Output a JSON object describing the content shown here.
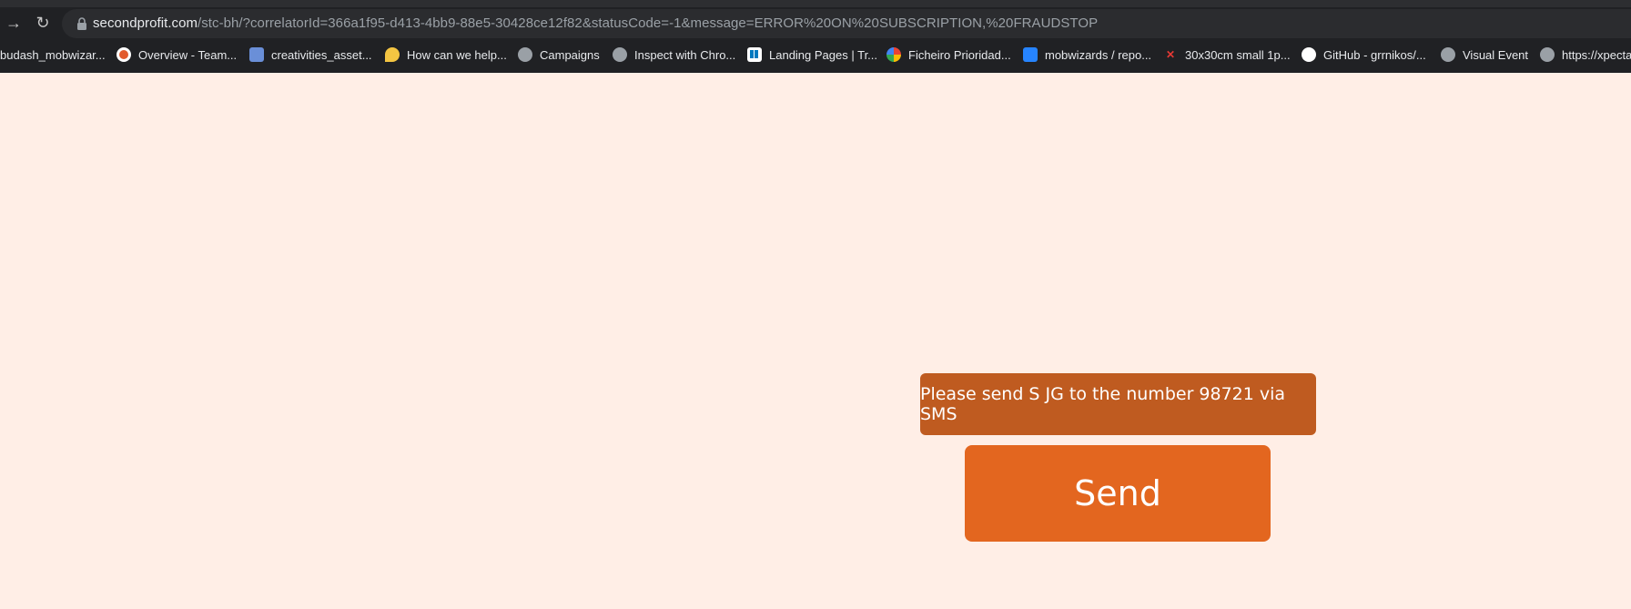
{
  "browser": {
    "url_host": "secondprofit.com",
    "url_path": "/stc-bh/?correlatorId=366a1f95-d413-4bb9-88e5-30428ce12f82&statusCode=-1&message=ERROR%20ON%20SUBSCRIPTION,%20FRAUDSTOP",
    "bookmarks": [
      {
        "label": "budash_mobwizar...",
        "icon": "none"
      },
      {
        "label": "Overview - Team...",
        "icon": "mobwizards-icon"
      },
      {
        "label": "creativities_asset...",
        "icon": "grid-icon"
      },
      {
        "label": "How can we help...",
        "icon": "help-icon"
      },
      {
        "label": "Campaigns",
        "icon": "globe-icon"
      },
      {
        "label": "Inspect with Chro...",
        "icon": "globe-icon"
      },
      {
        "label": "Landing Pages | Tr...",
        "icon": "trello-icon"
      },
      {
        "label": "Ficheiro Prioridad...",
        "icon": "google-icon"
      },
      {
        "label": "mobwizards / repo...",
        "icon": "bitbucket-icon"
      },
      {
        "label": "30x30cm small 1p...",
        "icon": "red-icon"
      },
      {
        "label": "GitHub - grrnikos/...",
        "icon": "github-icon"
      },
      {
        "label": "Visual Event",
        "icon": "globe-icon"
      },
      {
        "label": "https://xpecta",
        "icon": "globe-icon"
      }
    ]
  },
  "page": {
    "message": "Please send S JG to the number 98721 via SMS",
    "send_label": "Send",
    "colors": {
      "background": "#ffeee6",
      "message_bg": "#bf5b20",
      "button_bg": "#e3661f"
    }
  }
}
